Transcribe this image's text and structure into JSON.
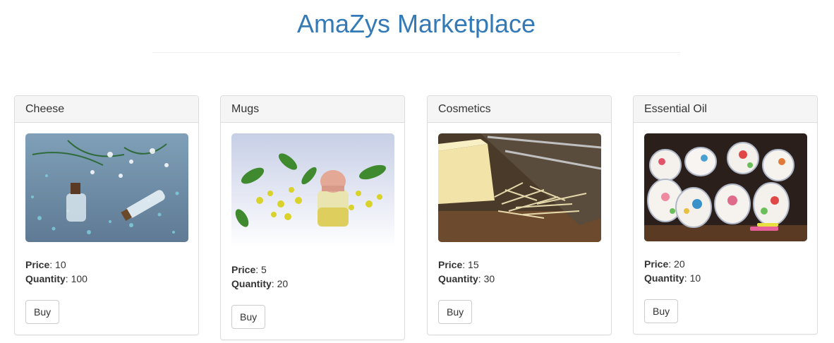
{
  "header": {
    "title": "AmaZys Marketplace"
  },
  "labels": {
    "price": "Price",
    "quantity": "Quantity",
    "buy": "Buy"
  },
  "products": [
    {
      "name": "Cheese",
      "price": "10",
      "quantity": "100",
      "image": "essential-oil-bottles-photo"
    },
    {
      "name": "Mugs",
      "price": "5",
      "quantity": "20",
      "image": "oil-bottle-with-yellow-flowers-photo"
    },
    {
      "name": "Cosmetics",
      "price": "15",
      "quantity": "30",
      "image": "grated-cheese-and-grater-photo"
    },
    {
      "name": "Essential Oil",
      "price": "20",
      "quantity": "10",
      "image": "stacked-floral-mugs-photo"
    }
  ]
}
